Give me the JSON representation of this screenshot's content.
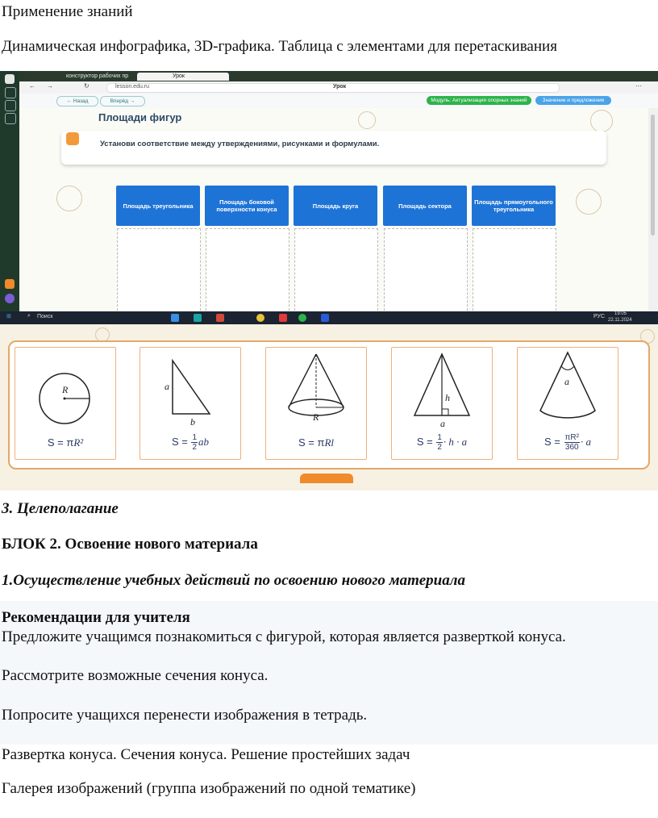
{
  "heading": "Применение знаний",
  "subheading": "Динамическая инфографика, 3D-графика. Таблица с элементами для перетаскивания",
  "screenshot": {
    "browser_tabs": [
      "конструктор рабочих пр",
      "Урок"
    ],
    "url": "lesson.edu.ru",
    "page_tab_title": "Урок",
    "nav_back": "← Назад",
    "nav_forward": "Вперёд →",
    "pill_module": "Модуль: Актуализация опорных знаний",
    "pill_meaning": "Значение и предложение",
    "lesson_title": "Площади фигур",
    "task_text": "Установи соответствие между утверждениями, рисунками и формулами.",
    "columns": [
      "Площадь треугольника",
      "Площадь боковой поверхности конуса",
      "Площадь круга",
      "Площадь сектора",
      "Площадь прямоугольного треугольника"
    ],
    "taskbar_search": "Поиск",
    "taskbar_lang": "РУС",
    "taskbar_time": "19:05",
    "taskbar_date": "22.11.2024",
    "colors": {
      "header_blue": "#1e73d6",
      "pill_green": "#2db34a",
      "pill_blue": "#4aa3e8",
      "panel_border": "#e4a867"
    }
  },
  "cards": [
    {
      "figure": "circle",
      "labels": [
        "R"
      ],
      "formula_prefix": "S = π",
      "formula_var": "R²"
    },
    {
      "figure": "right-triangle",
      "labels": [
        "a",
        "b"
      ],
      "formula_prefix": "S =",
      "frac_num": "1",
      "frac_den": "2",
      "formula_var": "ab"
    },
    {
      "figure": "cone",
      "labels": [
        "R"
      ],
      "formula_prefix": "S = π",
      "formula_var": "Rl"
    },
    {
      "figure": "triangle-height",
      "labels": [
        "h",
        "a"
      ],
      "formula_prefix": "S =",
      "frac_num": "1",
      "frac_den": "2",
      "formula_suffix": "· h · a"
    },
    {
      "figure": "sector",
      "labels": [
        "a"
      ],
      "formula_prefix": "S =",
      "frac_num": "πR²",
      "frac_den": "360",
      "formula_suffix": "· a"
    }
  ],
  "sections": {
    "goal": "3. Целеполагание",
    "block2": "БЛОК 2. Освоение нового материала",
    "actions": "1.Осуществление учебных действий по освоению нового материала",
    "rec_title": "Рекомендации для учителя",
    "rec_1": "Предложите учащимся познакомиться с фигурой, которая является разверткой конуса.",
    "rec_2": "Рассмотрите возможные сечения конуса.",
    "rec_3": "Попросите учащихся перенести изображения в тетрадь.",
    "line_topic": "Развертка конуса. Сечения конуса. Решение простейших задач",
    "line_gallery": "Галерея изображений (группа изображений по одной тематике)"
  }
}
